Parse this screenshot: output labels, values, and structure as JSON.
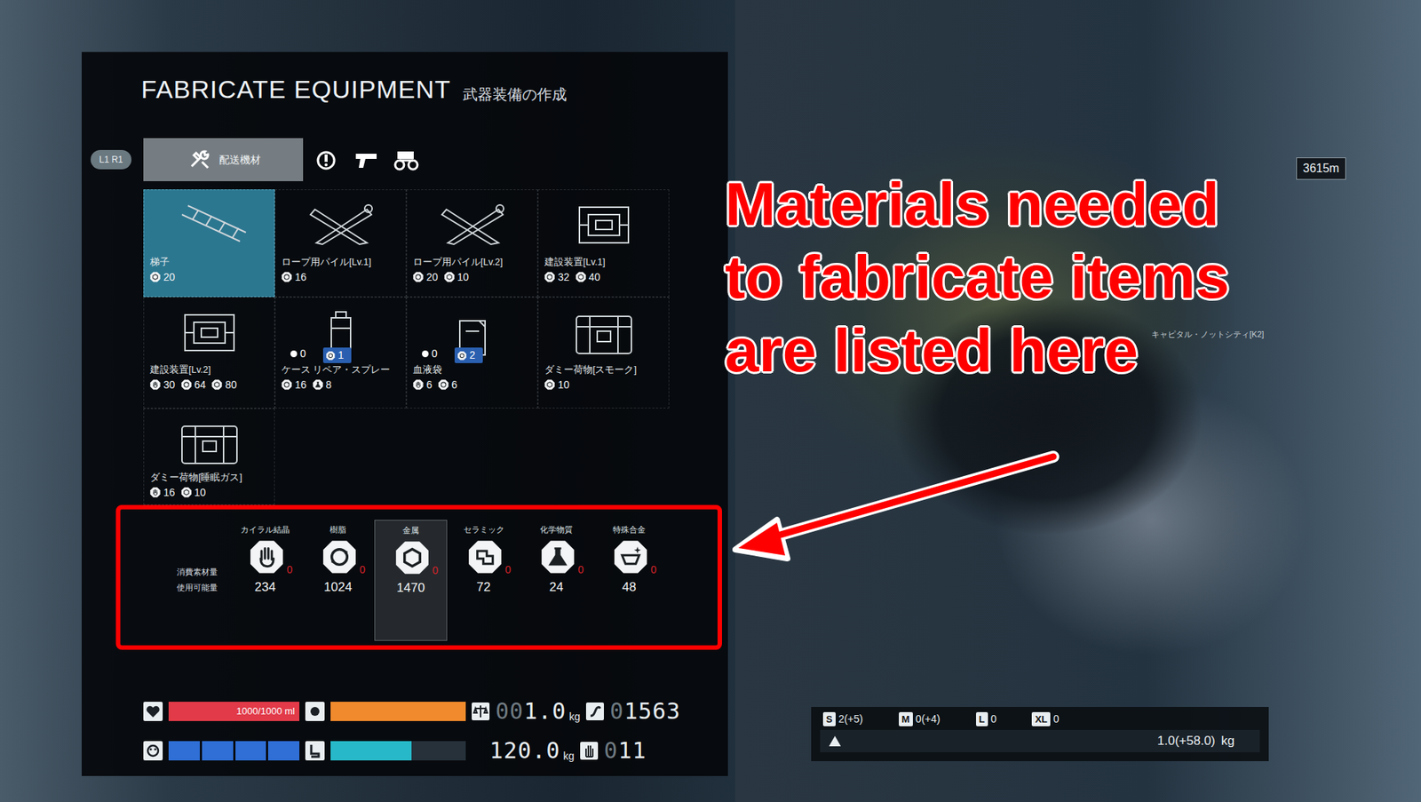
{
  "header": {
    "caption": "FABRICATE EQUIPMENT",
    "subtitle": "武器装備の作成"
  },
  "shoulder_buttons": "L1 R1",
  "tabs": [
    {
      "label": "配送機材",
      "kind": "tools",
      "selected": true
    },
    {
      "label": "",
      "kind": "grenade",
      "selected": false
    },
    {
      "label": "",
      "kind": "gun",
      "selected": false
    },
    {
      "label": "",
      "kind": "vehicle",
      "selected": false
    }
  ],
  "items": [
    {
      "name": "梯子",
      "kind": "ladder",
      "selected": true,
      "held": "",
      "count": "",
      "costs": [
        {
          "material": "metal",
          "amount": "20"
        }
      ]
    },
    {
      "name": "ロープ用パイル[Lv.1]",
      "kind": "pile",
      "selected": false,
      "held": "",
      "count": "",
      "costs": [
        {
          "material": "resin",
          "amount": "16"
        }
      ]
    },
    {
      "name": "ロープ用パイル[Lv.2]",
      "kind": "pile",
      "selected": false,
      "held": "",
      "count": "",
      "costs": [
        {
          "material": "resin",
          "amount": "20"
        },
        {
          "material": "metal",
          "amount": "10"
        }
      ]
    },
    {
      "name": "建設装置[Lv.1]",
      "kind": "device",
      "selected": false,
      "held": "",
      "count": "",
      "costs": [
        {
          "material": "resin",
          "amount": "32"
        },
        {
          "material": "metal",
          "amount": "40"
        }
      ]
    },
    {
      "name": "建設装置[Lv.2]",
      "kind": "device",
      "selected": false,
      "held": "",
      "count": "",
      "costs": [
        {
          "material": "chiral",
          "amount": "30"
        },
        {
          "material": "resin",
          "amount": "64"
        },
        {
          "material": "metal",
          "amount": "80"
        }
      ]
    },
    {
      "name": "ケース リペア・スプレー",
      "kind": "spray",
      "selected": false,
      "held": "0",
      "count": "1",
      "costs": [
        {
          "material": "resin",
          "amount": "16"
        },
        {
          "material": "chemical",
          "amount": "8"
        }
      ]
    },
    {
      "name": "血液袋",
      "kind": "bloodbag",
      "selected": false,
      "held": "0",
      "count": "2",
      "costs": [
        {
          "material": "chiral",
          "amount": "6"
        },
        {
          "material": "resin",
          "amount": "6"
        }
      ]
    },
    {
      "name": "ダミー荷物[スモーク]",
      "kind": "cargo",
      "selected": false,
      "held": "",
      "count": "",
      "costs": [
        {
          "material": "metal",
          "amount": "10"
        }
      ]
    },
    {
      "name": "ダミー荷物[睡眠ガス]",
      "kind": "cargo",
      "selected": false,
      "held": "",
      "count": "",
      "costs": [
        {
          "material": "chiral",
          "amount": "16"
        },
        {
          "material": "metal",
          "amount": "10"
        }
      ]
    }
  ],
  "materials": {
    "consumed_label": "消費素材量",
    "available_label": "使用可能量",
    "list": [
      {
        "name": "カイラル結晶",
        "kind": "chiral",
        "consumed": "0",
        "available": "234",
        "selected": false
      },
      {
        "name": "樹脂",
        "kind": "resin",
        "consumed": "0",
        "available": "1024",
        "selected": false
      },
      {
        "name": "金属",
        "kind": "metal",
        "consumed": "0",
        "available": "1470",
        "selected": true
      },
      {
        "name": "セラミック",
        "kind": "ceramic",
        "consumed": "0",
        "available": "72",
        "selected": false
      },
      {
        "name": "化学物質",
        "kind": "chemical",
        "consumed": "0",
        "available": "24",
        "selected": false
      },
      {
        "name": "特殊合金",
        "kind": "alloy",
        "consumed": "0",
        "available": "48",
        "selected": false
      }
    ]
  },
  "status": {
    "blood": {
      "reading": "1000/1000 ml",
      "level": 1
    },
    "stamina": {
      "level": 1
    },
    "health_segments": [
      true,
      true,
      true,
      true
    ],
    "boots": {
      "level": 0.6
    },
    "carried": {
      "dim": "00",
      "value": "1.0",
      "unit": "kg"
    },
    "capacity": {
      "value": "120.0",
      "unit": "kg"
    },
    "distance": {
      "dim": "0",
      "value": "1563"
    },
    "likes": {
      "dim": "0",
      "value": "11"
    }
  },
  "cargo": {
    "slots": [
      {
        "size": "S",
        "count": "2(+5)"
      },
      {
        "size": "M",
        "count": "0(+4)"
      },
      {
        "size": "L",
        "count": "0"
      },
      {
        "size": "XL",
        "count": "0"
      }
    ],
    "weight": "1.0(+58.0)",
    "unit": "kg"
  },
  "hud": {
    "distance": "3615m",
    "map_label": "キャピタル・ノットシティ[K2]"
  },
  "annotation": {
    "lines": [
      "Materials needed",
      "to fabricate items",
      "are listed here"
    ]
  }
}
